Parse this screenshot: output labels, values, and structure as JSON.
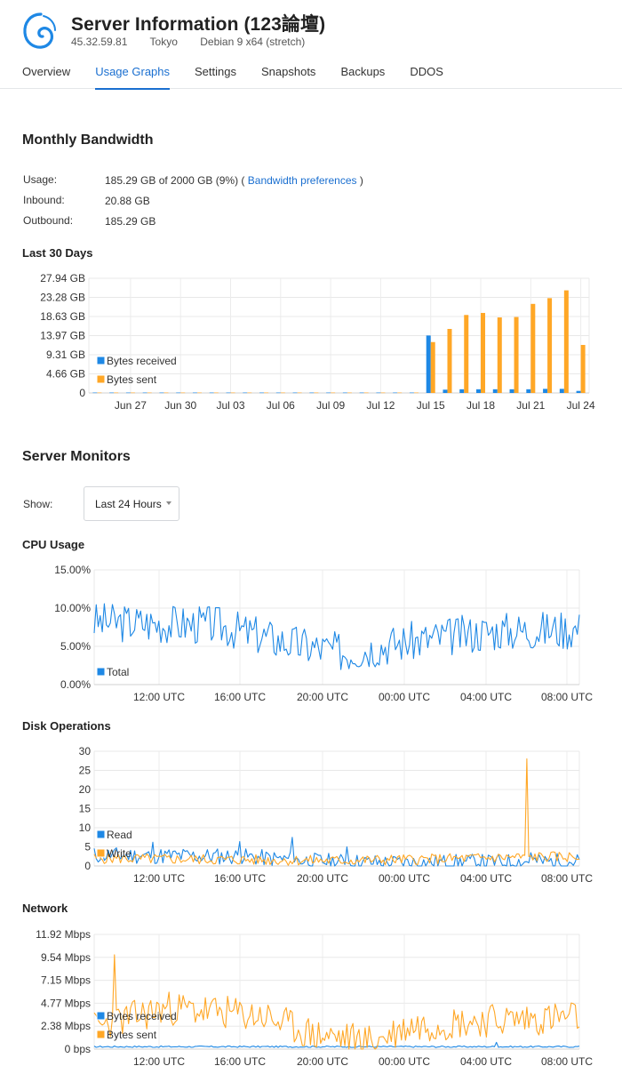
{
  "header": {
    "title": "Server Information (123論壇)",
    "ip": "45.32.59.81",
    "location": "Tokyo",
    "os": "Debian 9 x64 (stretch)",
    "logo_icon": "debian-swirl-icon"
  },
  "tabs": [
    {
      "label": "Overview",
      "active": false
    },
    {
      "label": "Usage Graphs",
      "active": true
    },
    {
      "label": "Settings",
      "active": false
    },
    {
      "label": "Snapshots",
      "active": false
    },
    {
      "label": "Backups",
      "active": false
    },
    {
      "label": "DDOS",
      "active": false
    }
  ],
  "bandwidth": {
    "heading": "Monthly Bandwidth",
    "usage_label": "Usage:",
    "usage_value": "185.29 GB of 2000 GB (9%) (",
    "usage_link": "Bandwidth preferences",
    "usage_close": ")",
    "inbound_label": "Inbound:",
    "inbound_value": "20.88 GB",
    "outbound_label": "Outbound:",
    "outbound_value": "185.29 GB"
  },
  "monitors": {
    "heading": "Server Monitors",
    "show_label": "Show:",
    "show_value": "Last 24 Hours"
  },
  "colors": {
    "blue": "#1e88e5",
    "orange": "#ffa726",
    "accent": "#1a6fd0",
    "grid": "#e8e8e8"
  },
  "chart_data": [
    {
      "id": "bandwidth",
      "title": "Last 30 Days",
      "type": "bar",
      "y_tick_labels": [
        "27.94 GB",
        "23.28 GB",
        "18.63 GB",
        "13.97 GB",
        "9.31 GB",
        "4.66 GB",
        "0"
      ],
      "x_tick_labels": [
        "Jun 27",
        "Jun 30",
        "Jul 03",
        "Jul 06",
        "Jul 09",
        "Jul 12",
        "Jul 15",
        "Jul 18",
        "Jul 21",
        "Jul 24"
      ],
      "ylim": [
        0,
        27.94
      ],
      "legend_position": "bottom-left",
      "categories": [
        "Jun 25",
        "Jun 26",
        "Jun 27",
        "Jun 28",
        "Jun 29",
        "Jun 30",
        "Jul 01",
        "Jul 02",
        "Jul 03",
        "Jul 04",
        "Jul 05",
        "Jul 06",
        "Jul 07",
        "Jul 08",
        "Jul 09",
        "Jul 10",
        "Jul 11",
        "Jul 12",
        "Jul 13",
        "Jul 14",
        "Jul 15",
        "Jul 16",
        "Jul 17",
        "Jul 18",
        "Jul 19",
        "Jul 20",
        "Jul 21",
        "Jul 22",
        "Jul 23",
        "Jul 24"
      ],
      "series": [
        {
          "name": "Bytes received",
          "color": "#1e88e5",
          "values": [
            0.1,
            0.1,
            0.1,
            0.1,
            0.1,
            0.1,
            0.1,
            0.1,
            0.1,
            0.1,
            0.1,
            0.1,
            0.1,
            0.1,
            0.1,
            0.1,
            0.1,
            0.1,
            0.1,
            0.1,
            14.0,
            0.8,
            0.9,
            0.9,
            0.9,
            0.9,
            0.9,
            1.0,
            1.0,
            0.5
          ]
        },
        {
          "name": "Bytes sent",
          "color": "#ffa726",
          "values": [
            0.1,
            0.1,
            0.1,
            0.1,
            0.1,
            0.1,
            0.1,
            0.1,
            0.1,
            0.1,
            0.1,
            0.1,
            0.1,
            0.1,
            0.1,
            0.1,
            0.1,
            0.1,
            0.1,
            0.1,
            12.4,
            15.6,
            19.0,
            19.5,
            18.4,
            18.5,
            21.7,
            23.1,
            25.0,
            11.7
          ]
        }
      ]
    },
    {
      "id": "cpu",
      "title": "CPU Usage",
      "type": "line",
      "y_tick_labels": [
        "15.00%",
        "10.00%",
        "5.00%",
        "0.00%"
      ],
      "x_tick_labels": [
        "12:00 UTC",
        "16:00 UTC",
        "20:00 UTC",
        "00:00 UTC",
        "04:00 UTC",
        "08:00 UTC"
      ],
      "ylim": [
        0,
        15
      ],
      "legend_position": "bottom-left",
      "series": [
        {
          "name": "Total",
          "color": "#1e88e5",
          "profile": [
            [
              0,
              8.2
            ],
            [
              0.25,
              7.8
            ],
            [
              0.42,
              5.2
            ],
            [
              0.52,
              4.2
            ],
            [
              0.62,
              5.4
            ],
            [
              0.82,
              7.0
            ],
            [
              1,
              7.3
            ]
          ],
          "amp": 2.6,
          "seed": 3,
          "spikes": []
        }
      ]
    },
    {
      "id": "disk",
      "title": "Disk Operations",
      "type": "line",
      "y_tick_labels": [
        "30",
        "25",
        "20",
        "15",
        "10",
        "5",
        "0"
      ],
      "x_tick_labels": [
        "12:00 UTC",
        "16:00 UTC",
        "20:00 UTC",
        "00:00 UTC",
        "04:00 UTC",
        "08:00 UTC"
      ],
      "ylim": [
        0,
        30
      ],
      "legend_position": "bottom-left",
      "series": [
        {
          "name": "Read",
          "color": "#1e88e5",
          "profile": [
            [
              0,
              2.8
            ],
            [
              0.3,
              2.5
            ],
            [
              0.45,
              1.3
            ],
            [
              0.6,
              0.8
            ],
            [
              0.8,
              1.0
            ],
            [
              1,
              1.2
            ]
          ],
          "amp": 2.2,
          "seed": 11,
          "spikes": [
            [
              0.12,
              6.2
            ],
            [
              0.3,
              6.4
            ],
            [
              0.41,
              7.5
            ],
            [
              0.52,
              5.0
            ],
            [
              0.9,
              3.5
            ]
          ]
        },
        {
          "name": "Write",
          "color": "#ffa726",
          "profile": [
            [
              0,
              2.0
            ],
            [
              0.3,
              1.6
            ],
            [
              0.5,
              1.4
            ],
            [
              0.7,
              1.8
            ],
            [
              0.9,
              2.4
            ],
            [
              1,
              2.4
            ]
          ],
          "amp": 1.4,
          "seed": 5,
          "spikes": [
            [
              0.89,
              28.0
            ]
          ]
        }
      ]
    },
    {
      "id": "network",
      "title": "Network",
      "type": "line",
      "y_tick_labels": [
        "11.92 Mbps",
        "9.54 Mbps",
        "7.15 Mbps",
        "4.77 Mbps",
        "2.38 Mbps",
        "0 bps"
      ],
      "x_tick_labels": [
        "12:00 UTC",
        "16:00 UTC",
        "20:00 UTC",
        "00:00 UTC",
        "04:00 UTC",
        "08:00 UTC"
      ],
      "ylim": [
        0,
        11.92
      ],
      "legend_position": "bottom-left",
      "series": [
        {
          "name": "Bytes received",
          "color": "#1e88e5",
          "profile": [
            [
              0,
              0.25
            ],
            [
              1,
              0.25
            ]
          ],
          "amp": 0.08,
          "seed": 17,
          "spikes": [
            [
              0.83,
              0.7
            ]
          ]
        },
        {
          "name": "Bytes sent",
          "color": "#ffa726",
          "profile": [
            [
              0,
              2.2
            ],
            [
              0.15,
              4.3
            ],
            [
              0.35,
              3.4
            ],
            [
              0.45,
              1.5
            ],
            [
              0.58,
              0.8
            ],
            [
              0.65,
              2.4
            ],
            [
              0.8,
              3.0
            ],
            [
              1,
              3.3
            ]
          ],
          "amp": 1.8,
          "seed": 23,
          "spikes": [
            [
              0.04,
              9.8
            ]
          ]
        }
      ]
    }
  ]
}
